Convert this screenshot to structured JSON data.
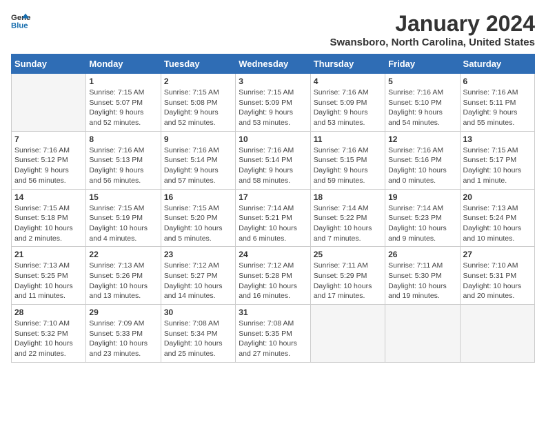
{
  "header": {
    "logo_line1": "General",
    "logo_line2": "Blue",
    "main_title": "January 2024",
    "sub_title": "Swansboro, North Carolina, United States"
  },
  "weekdays": [
    "Sunday",
    "Monday",
    "Tuesday",
    "Wednesday",
    "Thursday",
    "Friday",
    "Saturday"
  ],
  "weeks": [
    [
      {
        "day": "",
        "info": ""
      },
      {
        "day": "1",
        "info": "Sunrise: 7:15 AM\nSunset: 5:07 PM\nDaylight: 9 hours\nand 52 minutes."
      },
      {
        "day": "2",
        "info": "Sunrise: 7:15 AM\nSunset: 5:08 PM\nDaylight: 9 hours\nand 52 minutes."
      },
      {
        "day": "3",
        "info": "Sunrise: 7:15 AM\nSunset: 5:09 PM\nDaylight: 9 hours\nand 53 minutes."
      },
      {
        "day": "4",
        "info": "Sunrise: 7:16 AM\nSunset: 5:09 PM\nDaylight: 9 hours\nand 53 minutes."
      },
      {
        "day": "5",
        "info": "Sunrise: 7:16 AM\nSunset: 5:10 PM\nDaylight: 9 hours\nand 54 minutes."
      },
      {
        "day": "6",
        "info": "Sunrise: 7:16 AM\nSunset: 5:11 PM\nDaylight: 9 hours\nand 55 minutes."
      }
    ],
    [
      {
        "day": "7",
        "info": "Sunrise: 7:16 AM\nSunset: 5:12 PM\nDaylight: 9 hours\nand 56 minutes."
      },
      {
        "day": "8",
        "info": "Sunrise: 7:16 AM\nSunset: 5:13 PM\nDaylight: 9 hours\nand 56 minutes."
      },
      {
        "day": "9",
        "info": "Sunrise: 7:16 AM\nSunset: 5:14 PM\nDaylight: 9 hours\nand 57 minutes."
      },
      {
        "day": "10",
        "info": "Sunrise: 7:16 AM\nSunset: 5:14 PM\nDaylight: 9 hours\nand 58 minutes."
      },
      {
        "day": "11",
        "info": "Sunrise: 7:16 AM\nSunset: 5:15 PM\nDaylight: 9 hours\nand 59 minutes."
      },
      {
        "day": "12",
        "info": "Sunrise: 7:16 AM\nSunset: 5:16 PM\nDaylight: 10 hours\nand 0 minutes."
      },
      {
        "day": "13",
        "info": "Sunrise: 7:15 AM\nSunset: 5:17 PM\nDaylight: 10 hours\nand 1 minute."
      }
    ],
    [
      {
        "day": "14",
        "info": "Sunrise: 7:15 AM\nSunset: 5:18 PM\nDaylight: 10 hours\nand 2 minutes."
      },
      {
        "day": "15",
        "info": "Sunrise: 7:15 AM\nSunset: 5:19 PM\nDaylight: 10 hours\nand 4 minutes."
      },
      {
        "day": "16",
        "info": "Sunrise: 7:15 AM\nSunset: 5:20 PM\nDaylight: 10 hours\nand 5 minutes."
      },
      {
        "day": "17",
        "info": "Sunrise: 7:14 AM\nSunset: 5:21 PM\nDaylight: 10 hours\nand 6 minutes."
      },
      {
        "day": "18",
        "info": "Sunrise: 7:14 AM\nSunset: 5:22 PM\nDaylight: 10 hours\nand 7 minutes."
      },
      {
        "day": "19",
        "info": "Sunrise: 7:14 AM\nSunset: 5:23 PM\nDaylight: 10 hours\nand 9 minutes."
      },
      {
        "day": "20",
        "info": "Sunrise: 7:13 AM\nSunset: 5:24 PM\nDaylight: 10 hours\nand 10 minutes."
      }
    ],
    [
      {
        "day": "21",
        "info": "Sunrise: 7:13 AM\nSunset: 5:25 PM\nDaylight: 10 hours\nand 11 minutes."
      },
      {
        "day": "22",
        "info": "Sunrise: 7:13 AM\nSunset: 5:26 PM\nDaylight: 10 hours\nand 13 minutes."
      },
      {
        "day": "23",
        "info": "Sunrise: 7:12 AM\nSunset: 5:27 PM\nDaylight: 10 hours\nand 14 minutes."
      },
      {
        "day": "24",
        "info": "Sunrise: 7:12 AM\nSunset: 5:28 PM\nDaylight: 10 hours\nand 16 minutes."
      },
      {
        "day": "25",
        "info": "Sunrise: 7:11 AM\nSunset: 5:29 PM\nDaylight: 10 hours\nand 17 minutes."
      },
      {
        "day": "26",
        "info": "Sunrise: 7:11 AM\nSunset: 5:30 PM\nDaylight: 10 hours\nand 19 minutes."
      },
      {
        "day": "27",
        "info": "Sunrise: 7:10 AM\nSunset: 5:31 PM\nDaylight: 10 hours\nand 20 minutes."
      }
    ],
    [
      {
        "day": "28",
        "info": "Sunrise: 7:10 AM\nSunset: 5:32 PM\nDaylight: 10 hours\nand 22 minutes."
      },
      {
        "day": "29",
        "info": "Sunrise: 7:09 AM\nSunset: 5:33 PM\nDaylight: 10 hours\nand 23 minutes."
      },
      {
        "day": "30",
        "info": "Sunrise: 7:08 AM\nSunset: 5:34 PM\nDaylight: 10 hours\nand 25 minutes."
      },
      {
        "day": "31",
        "info": "Sunrise: 7:08 AM\nSunset: 5:35 PM\nDaylight: 10 hours\nand 27 minutes."
      },
      {
        "day": "",
        "info": ""
      },
      {
        "day": "",
        "info": ""
      },
      {
        "day": "",
        "info": ""
      }
    ]
  ]
}
